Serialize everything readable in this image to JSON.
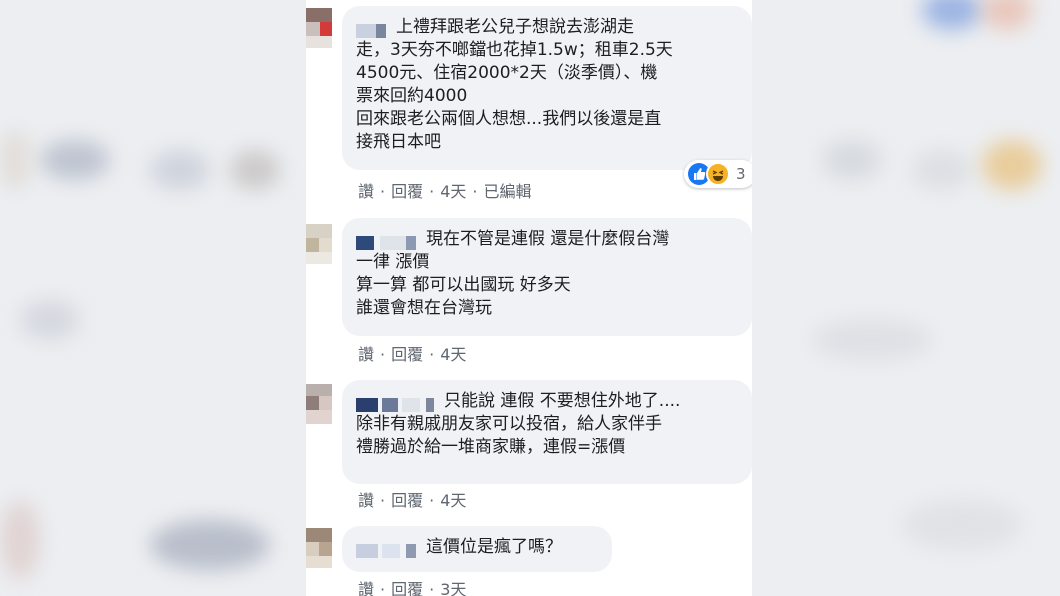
{
  "comments": [
    {
      "lines": [
        "上禮拜跟老公兒子想說去澎湖走",
        "走，3天夯不啷鐺也花掉1.5w；租車2.5天",
        "4500元、住宿2000*2天（淡季價）、機",
        "票來回約4000",
        "回來跟老公兩個人想想...我們以後還是直",
        "接飛日本吧"
      ],
      "actions": {
        "like": "讚",
        "reply": "回覆",
        "time": "4天",
        "edited": "已編輯"
      },
      "reactions": {
        "count": "3",
        "icons": [
          "like-icon",
          "haha-icon"
        ]
      }
    },
    {
      "lines": [
        "現在不管是連假 還是什麼假台灣",
        "一律 漲價",
        "算一算 都可以出國玩 好多天",
        "誰還會想在台灣玩"
      ],
      "actions": {
        "like": "讚",
        "reply": "回覆",
        "time": "4天"
      }
    },
    {
      "lines": [
        "只能說 連假 不要想住外地了....",
        "除非有親戚朋友家可以投宿，給人家伴手",
        "禮勝過於給一堆商家賺，連假=漲價"
      ],
      "actions": {
        "like": "讚",
        "reply": "回覆",
        "time": "4天"
      }
    },
    {
      "lines": [
        "這價位是瘋了嗎？"
      ],
      "actions": {
        "like": "讚",
        "reply": "回覆",
        "time": "3天"
      }
    }
  ],
  "separator": "·"
}
